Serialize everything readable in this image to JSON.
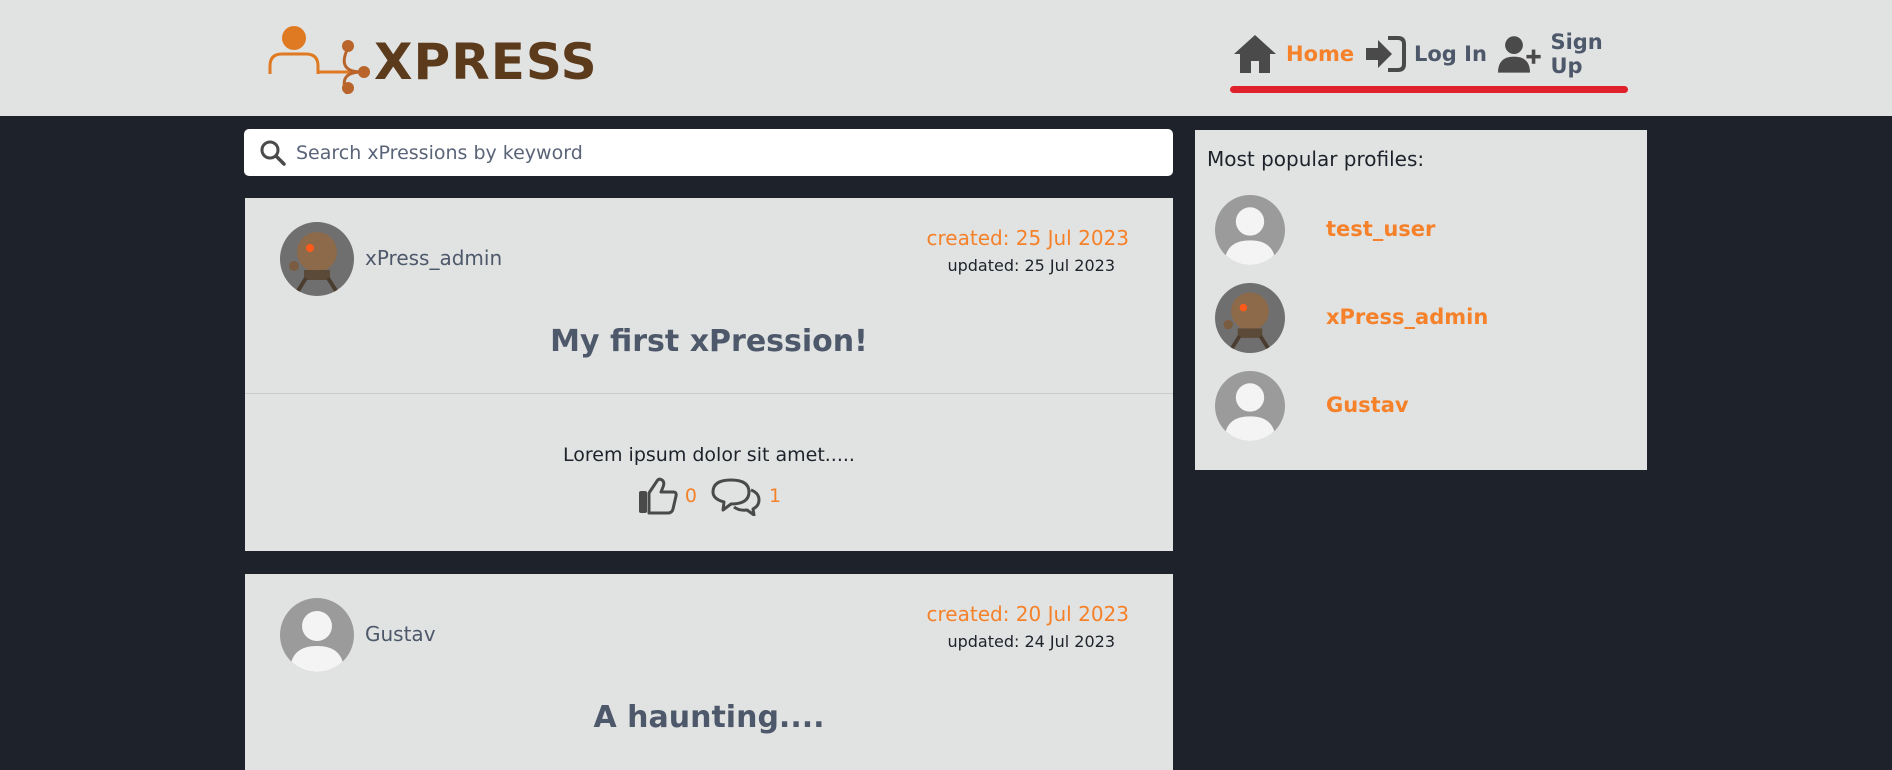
{
  "brand": {
    "name": "XPRESS"
  },
  "nav": {
    "home": "Home",
    "login": "Log In",
    "signup": "Sign Up"
  },
  "search": {
    "placeholder": "Search xPressions by keyword"
  },
  "posts": [
    {
      "author": "xPress_admin",
      "created": "created: 25 Jul 2023",
      "updated": "updated: 25 Jul 2023",
      "title": "My first xPression!",
      "body": "Lorem ipsum dolor sit amet.....",
      "likes": "0",
      "comments": "1"
    },
    {
      "author": "Gustav",
      "created": "created: 20 Jul 2023",
      "updated": "updated: 24 Jul 2023",
      "title": "A haunting...."
    }
  ],
  "sidebar": {
    "title": "Most popular profiles:",
    "profiles": [
      {
        "name": "test_user"
      },
      {
        "name": "xPress_admin"
      },
      {
        "name": "Gustav"
      }
    ]
  },
  "colors": {
    "accent": "#f5812a",
    "header_bg": "#e1e3e2",
    "page_bg": "#1e222a",
    "nav_underline": "#e0202a",
    "text_slate": "#4e586b"
  }
}
